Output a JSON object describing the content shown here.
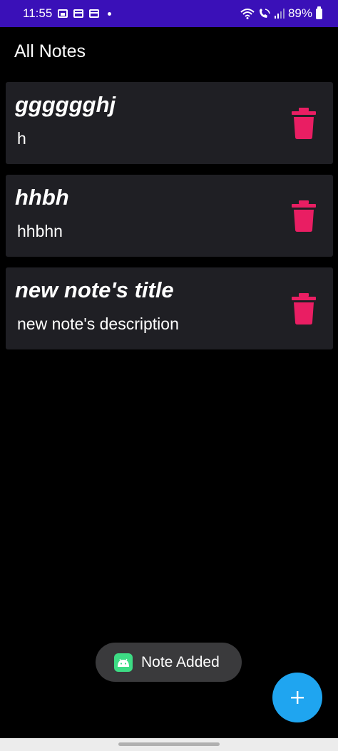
{
  "status_bar": {
    "time": "11:55",
    "battery": "89%",
    "background": "#3a10b8"
  },
  "header": {
    "title": "All Notes"
  },
  "notes": [
    {
      "title": "gggggghj",
      "description": "h"
    },
    {
      "title": "hhbh",
      "description": "hhbhn"
    },
    {
      "title": "new note's title",
      "description": "new note's description"
    }
  ],
  "toast": {
    "message": "Note Added",
    "icon": "android-icon"
  },
  "fab": {
    "icon": "plus-icon",
    "color": "#1fa5f0"
  },
  "colors": {
    "background": "#000000",
    "card": "#1f1f24",
    "delete": "#e91e63"
  }
}
